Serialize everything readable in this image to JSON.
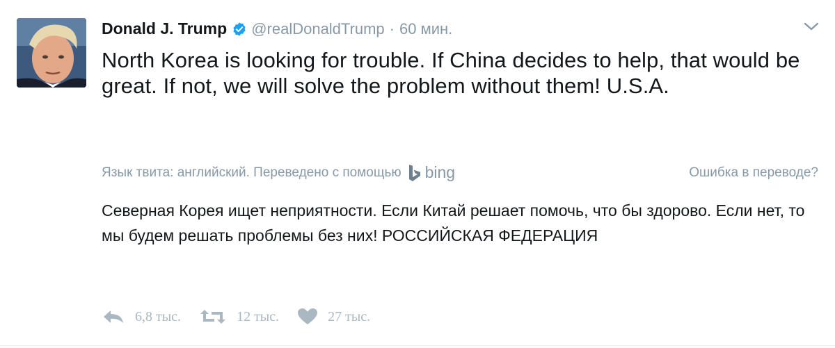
{
  "tweet": {
    "author_name": "Donald J. Trump",
    "handle": "@realDonaldTrump",
    "separator": "·",
    "time": "60 мин.",
    "text": "North Korea is looking for trouble. If China decides to help, that would be great. If not, we will solve the problem without them! U.S.A.",
    "verified": true
  },
  "translation": {
    "language_note": "Язык твита: английский. Переведено с помощью",
    "provider": "bing",
    "error_link": "Ошибка в переводе?",
    "text": "Северная Корея ищет неприятности. Если Китай решает помочь, что бы здорово. Если нет, то мы будем решать проблемы без них!  РОССИЙСКАЯ ФЕДЕРАЦИЯ"
  },
  "actions": {
    "reply_count": "6,8 тыс.",
    "retweet_count": "12 тыс.",
    "like_count": "27 тыс."
  },
  "icons": {
    "verified": "verified-badge-icon",
    "caret": "chevron-down-icon",
    "bing": "bing-logo-icon",
    "reply": "reply-icon",
    "retweet": "retweet-icon",
    "like": "heart-icon"
  },
  "colors": {
    "verified_blue": "#1da1f2",
    "muted_gray": "#8899a6",
    "icon_gray": "#aab8c2",
    "text": "#14171a"
  }
}
